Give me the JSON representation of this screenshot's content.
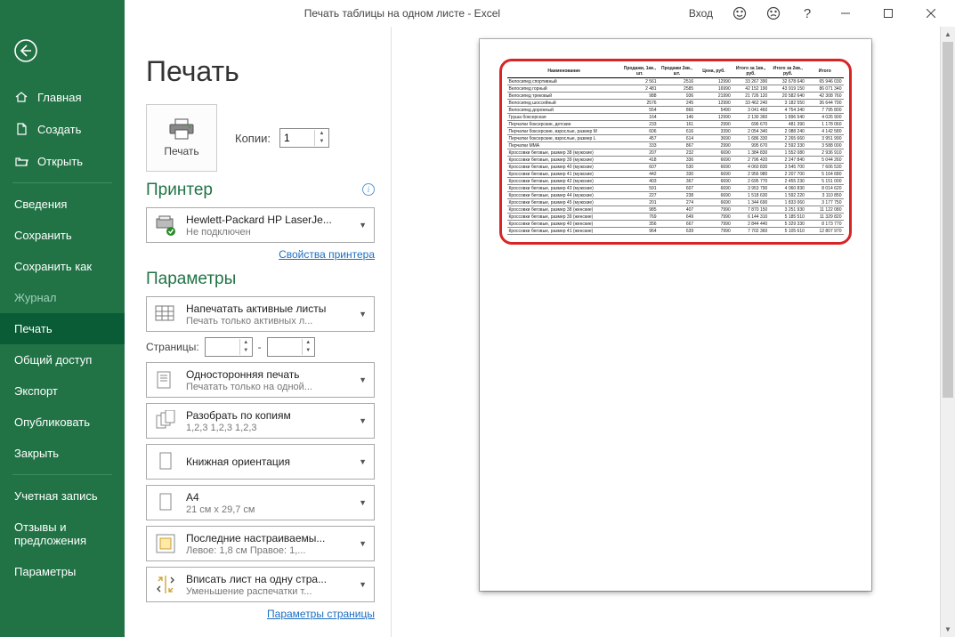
{
  "titlebar": {
    "title": "Печать таблицы на одном листе  -  Excel",
    "login": "Вход",
    "help": "?"
  },
  "sidebar": {
    "top": [
      {
        "icon": "home",
        "label": "Главная"
      },
      {
        "icon": "new",
        "label": "Создать"
      },
      {
        "icon": "open",
        "label": "Открыть"
      }
    ],
    "mid": [
      {
        "label": "Сведения"
      },
      {
        "label": "Сохранить"
      },
      {
        "label": "Сохранить как"
      },
      {
        "label": "Журнал",
        "disabled": true
      },
      {
        "label": "Печать",
        "active": true
      },
      {
        "label": "Общий доступ"
      },
      {
        "label": "Экспорт"
      },
      {
        "label": "Опубликовать"
      },
      {
        "label": "Закрыть"
      }
    ],
    "bot": [
      {
        "label": "Учетная запись"
      },
      {
        "label": "Отзывы и предложения"
      },
      {
        "label": "Параметры"
      }
    ]
  },
  "print": {
    "heading": "Печать",
    "print_label": "Печать",
    "copies_label": "Копии:",
    "copies_value": "1",
    "printer_heading": "Принтер",
    "printer_name": "Hewlett-Packard HP LaserJe...",
    "printer_status": "Не подключен",
    "printer_props": "Свойства принтера",
    "params_heading": "Параметры",
    "active_sheets": "Напечатать активные листы",
    "active_sheets_sub": "Печать только активных л...",
    "pages_label": "Страницы:",
    "pages_sep": "-",
    "onesided": "Односторонняя печать",
    "onesided_sub": "Печатать только на одной...",
    "collate": "Разобрать по копиям",
    "collate_sub": "1,2,3    1,2,3    1,2,3",
    "orientation": "Книжная ориентация",
    "paper": "A4",
    "paper_sub": "21 см x 29,7 см",
    "margins": "Последние настраиваемы...",
    "margins_sub": "Левое:  1,8 см   Правое:  1,...",
    "fit": "Вписать лист на одну стра...",
    "fit_sub": "Уменьшение распечатки т...",
    "page_params": "Параметры страницы"
  },
  "chart_data": {
    "type": "table",
    "title": "Наименование",
    "columns": [
      "Наименование",
      "Продажи, 1кв., шт.",
      "Продажи 2кв., шт.",
      "Цена, руб.",
      "Итого за 1кв., руб.",
      "Итого за 2кв., руб.",
      "Итого"
    ],
    "rows": [
      [
        "Велосипед спортивный",
        "2 561",
        "2516",
        "12990",
        "33 267 390",
        "32 678 640",
        "65 946 030"
      ],
      [
        "Велосипед горный",
        "2 481",
        "2585",
        "16990",
        "42 152 190",
        "43 919 150",
        "86 071 340"
      ],
      [
        "Велосипед трековый",
        "988",
        "936",
        "21990",
        "21 726 120",
        "20 582 640",
        "42 308 760"
      ],
      [
        "Велосипед шоссейный",
        "2576",
        "245",
        "12990",
        "33 462 240",
        "3 182 550",
        "36 644 790"
      ],
      [
        "Велосипед дорожный",
        "554",
        "866",
        "5490",
        "3 041 460",
        "4 754 340",
        "7 795 800"
      ],
      [
        "Груша боксерская",
        "164",
        "146",
        "12990",
        "2 130 360",
        "1 896 540",
        "4 026 900"
      ],
      [
        "Перчатки боксерские, детские",
        "233",
        "161",
        "2990",
        "696 670",
        "481 390",
        "1 178 060"
      ],
      [
        "Перчатки боксерские, взрослые, размер М",
        "606",
        "616",
        "3390",
        "2 054 340",
        "2 088 240",
        "4 142 580"
      ],
      [
        "Перчатки боксерские, взрослые, размер L",
        "457",
        "614",
        "3690",
        "1 686 330",
        "2 265 660",
        "3 951 990"
      ],
      [
        "Перчатки ММА",
        "333",
        "867",
        "2990",
        "995 670",
        "2 592 330",
        "3 588 000"
      ],
      [
        "Кроссовки беговые, размер 38 (мужские)",
        "207",
        "232",
        "6690",
        "1 384 830",
        "1 552 080",
        "2 936 910"
      ],
      [
        "Кроссовки беговые, размер 39 (мужские)",
        "418",
        "336",
        "6690",
        "2 796 420",
        "2 247 840",
        "5 044 260"
      ],
      [
        "Кроссовки беговые, размер 40 (мужские)",
        "607",
        "530",
        "6690",
        "4 060 830",
        "3 545 700",
        "7 606 530"
      ],
      [
        "Кроссовки беговые, размер 41 (мужские)",
        "442",
        "330",
        "6690",
        "2 956 980",
        "2 207 700",
        "5 164 680"
      ],
      [
        "Кроссовки беговые, размер 42 (мужские)",
        "403",
        "367",
        "6690",
        "2 695 770",
        "2 455 230",
        "5 151 000"
      ],
      [
        "Кроссовки беговые, размер 43 (мужские)",
        "591",
        "607",
        "6690",
        "3 953 790",
        "4 060 830",
        "8 014 620"
      ],
      [
        "Кроссовки беговые, размер 44 (мужские)",
        "227",
        "238",
        "6690",
        "1 518 630",
        "1 592 220",
        "3 110 850"
      ],
      [
        "Кроссовки беговые, размер 45 (мужские)",
        "201",
        "274",
        "6690",
        "1 344 690",
        "1 833 060",
        "3 177 750"
      ],
      [
        "Кроссовки беговые, размер 38 (женские)",
        "985",
        "407",
        "7990",
        "7 870 150",
        "3 251 930",
        "11 122 080"
      ],
      [
        "Кроссовки беговые, размер 39 (женские)",
        "769",
        "649",
        "7990",
        "6 144 310",
        "5 185 510",
        "11 329 820"
      ],
      [
        "Кроссовки беговые, размер 40 (женские)",
        "356",
        "667",
        "7990",
        "2 844 440",
        "5 329 330",
        "8 173 770"
      ],
      [
        "Кроссовки беговые, размер 41 (женские)",
        "964",
        "639",
        "7990",
        "7 702 360",
        "5 105 610",
        "12 807 970"
      ]
    ]
  }
}
